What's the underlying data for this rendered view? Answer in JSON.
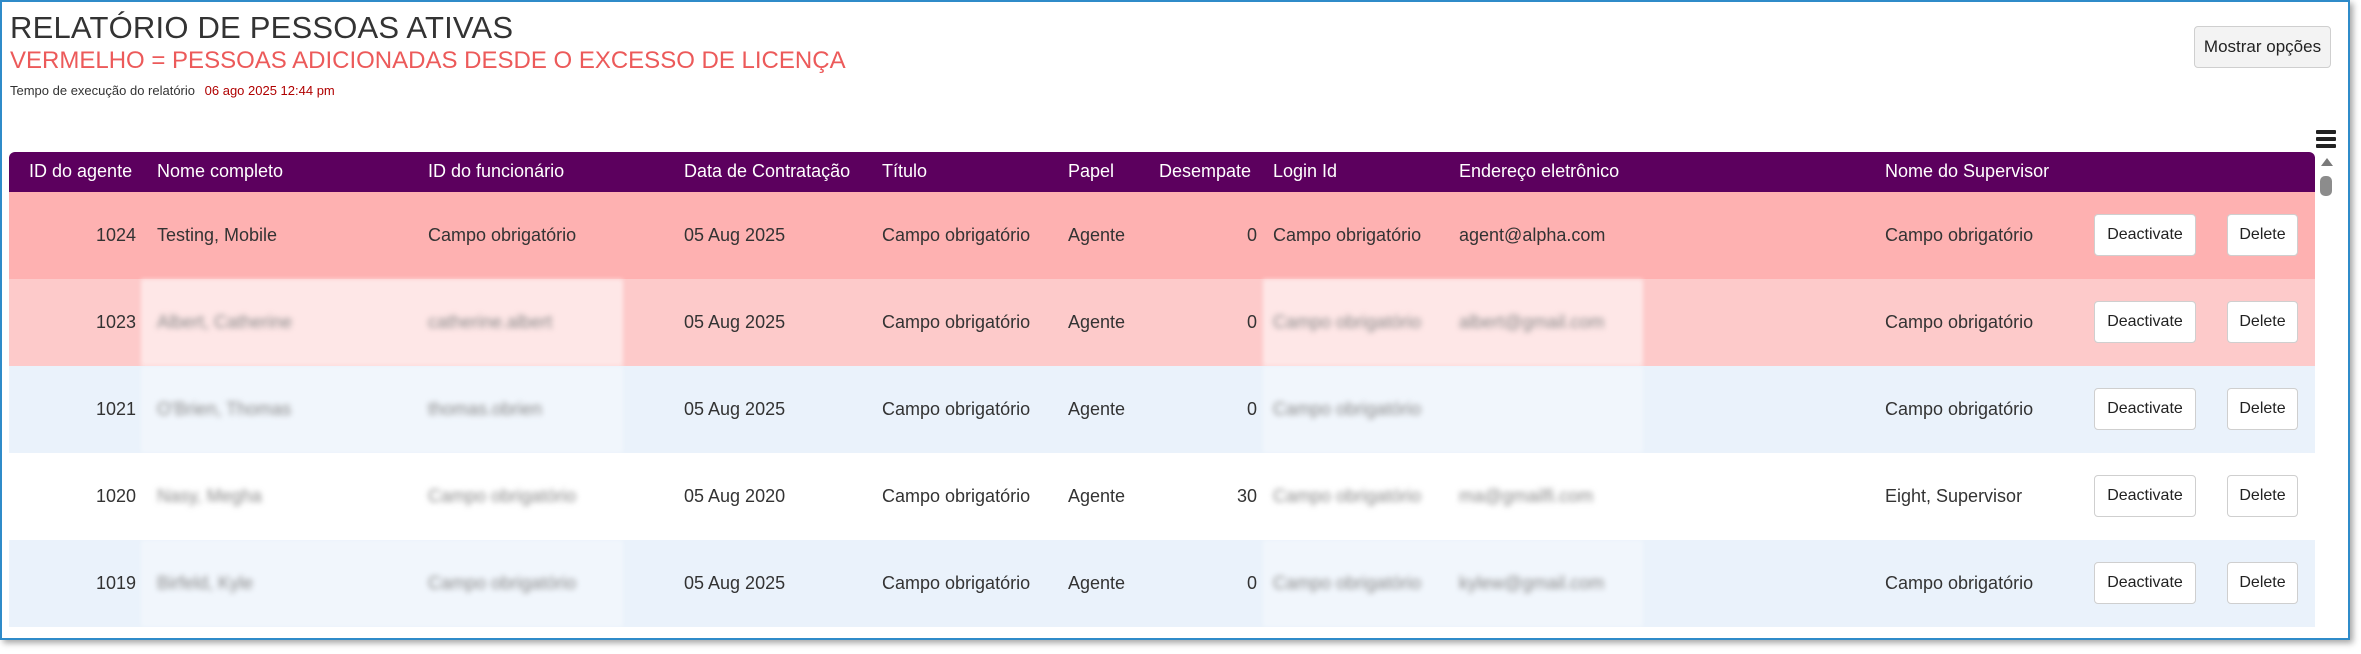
{
  "report": {
    "title": "RELATÓRIO DE PESSOAS ATIVAS",
    "subtitle": "VERMELHO = PESSOAS ADICIONADAS DESDE O EXCESSO DE LICENÇA",
    "runtime_label": "Tempo de execução do relatório",
    "runtime_value": "06 ago 2025 12:44 pm",
    "options_button": "Mostrar opções"
  },
  "colors": {
    "header_bg": "#5c005e",
    "row_red": "#feb1b1",
    "row_pink": "#fdcaca",
    "row_blue": "#eaf2fb",
    "subtitle_red": "#ec5a5a",
    "runtime_red": "#b00000"
  },
  "icons": {
    "menu": "hamburger-menu-icon",
    "scroll": "scroll-up-arrow-icon"
  },
  "table": {
    "headers": {
      "agent_id": "ID do agente",
      "full_name": "Nome completo",
      "employee_id": "ID do funcionário",
      "hire_date": "Data de Contratação",
      "title": "Título",
      "role": "Papel",
      "tiebreak": "Desempate",
      "login_id": "Login Id",
      "email": "Endereço eletrônico",
      "supervisor": "Nome do Supervisor"
    },
    "rows": [
      {
        "agent_id": "1024",
        "full_name": "Testing, Mobile",
        "employee_id": "Campo obrigatório",
        "hire_date": "05 Aug 2025",
        "title": "Campo obrigatório",
        "role": "Agente",
        "tiebreak": "0",
        "login_id": "Campo obrigatório",
        "email": "agent@alpha.com",
        "supervisor": "Campo obrigatório",
        "deactivate": "Deactivate",
        "delete": "Delete",
        "highlight": "red"
      },
      {
        "agent_id": "1023",
        "full_name": "Albert, Catherine",
        "employee_id": "catherine.albert",
        "hire_date": "05 Aug 2025",
        "title": "Campo obrigatório",
        "role": "Agente",
        "tiebreak": "0",
        "login_id": "Campo obrigatório",
        "email": "albert@gmail.com",
        "supervisor": "Campo obrigatório",
        "deactivate": "Deactivate",
        "delete": "Delete",
        "highlight": "pink"
      },
      {
        "agent_id": "1021",
        "full_name": "O'Brien, Thomas",
        "employee_id": "thomas.obrien",
        "hire_date": "05 Aug 2025",
        "title": "Campo obrigatório",
        "role": "Agente",
        "tiebreak": "0",
        "login_id": "Campo obrigatório",
        "email": "",
        "supervisor": "Campo obrigatório",
        "deactivate": "Deactivate",
        "delete": "Delete",
        "highlight": "blue"
      },
      {
        "agent_id": "1020",
        "full_name": "Nasy, Megha",
        "employee_id": "Campo obrigatório",
        "hire_date": "05 Aug 2020",
        "title": "Campo obrigatório",
        "role": "Agente",
        "tiebreak": "30",
        "login_id": "Campo obrigatório",
        "email": "ma@gmailfi.com",
        "supervisor": "Eight, Supervisor",
        "deactivate": "Deactivate",
        "delete": "Delete",
        "highlight": "white"
      },
      {
        "agent_id": "1019",
        "full_name": "Birfeld, Kyle",
        "employee_id": "Campo obrigatório",
        "hire_date": "05 Aug 2025",
        "title": "Campo obrigatório",
        "role": "Agente",
        "tiebreak": "0",
        "login_id": "Campo obrigatório",
        "email": "kylew@gmail.com",
        "supervisor": "Campo obrigatório",
        "deactivate": "Deactivate",
        "delete": "Delete",
        "highlight": "blue"
      }
    ]
  }
}
